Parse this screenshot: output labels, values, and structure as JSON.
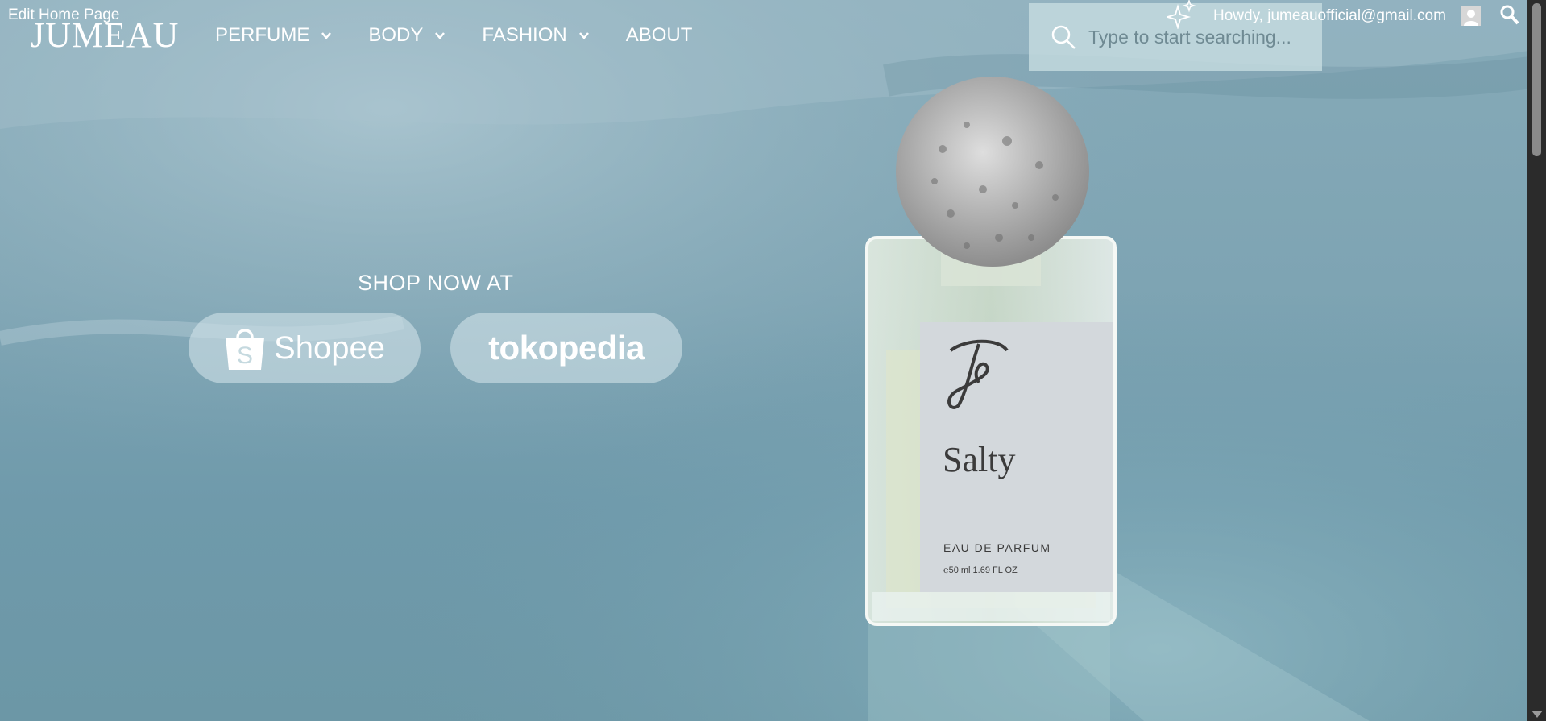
{
  "admin": {
    "edit_label": "Edit Home Page",
    "greeting": "Howdy, jumeauofficial@gmail.com"
  },
  "brand": {
    "logo_text": "JUMEAU"
  },
  "nav": {
    "items": [
      {
        "label": "PERFUME",
        "has_dropdown": true
      },
      {
        "label": "BODY",
        "has_dropdown": true
      },
      {
        "label": "FASHION",
        "has_dropdown": true
      },
      {
        "label": "ABOUT",
        "has_dropdown": false
      }
    ]
  },
  "search": {
    "placeholder": "Type to start searching..."
  },
  "hero": {
    "shop_title": "SHOP NOW AT",
    "stores": [
      {
        "label": "Shopee",
        "icon": "shopee-bag-icon"
      },
      {
        "label": "tokopedia",
        "icon": "tokopedia-logo"
      }
    ],
    "product": {
      "monogram": "𝒥",
      "name": "Salty",
      "type": "EAU DE PARFUM",
      "size": "℮50 ml 1.69 FL OZ"
    }
  },
  "colors": {
    "background": "#7ea4b3",
    "search_box": "#c8dee2",
    "button_fill": "#cee0e6",
    "text": "#ffffff"
  }
}
